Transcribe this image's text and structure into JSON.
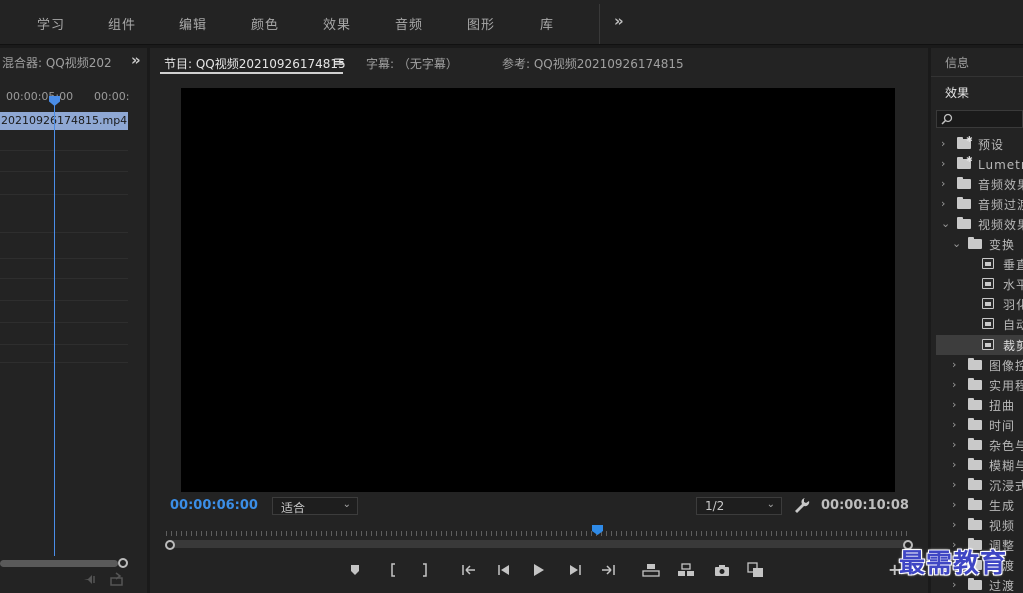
{
  "workspaces": [
    "学习",
    "组件",
    "编辑",
    "颜色",
    "效果",
    "音频",
    "图形",
    "库"
  ],
  "workspace_more": "»",
  "mixer": {
    "title": "混合器: QQ视频202",
    "more": "»",
    "ruler": [
      "00:00:05:00",
      "00:00:"
    ],
    "clip": "20210926174815.mp4"
  },
  "program": {
    "tab_program": "节目: QQ视频20210926174815",
    "menu": "≡",
    "tab_captions": "字幕: （无字幕）",
    "tab_reference": "参考: QQ视频20210926174815",
    "timecode_current": "00:00:06:00",
    "fit_select": "适合",
    "resolution_select": "1/2",
    "timecode_duration": "00:00:10:08",
    "plus": "+"
  },
  "effects_panel": {
    "tab_info": "信息",
    "tab_effects": "效果",
    "tree": [
      {
        "label": "预设",
        "level": 0,
        "chevron": "›",
        "icon": "star-folder"
      },
      {
        "label": "Lumetri 预设",
        "level": 0,
        "chevron": "›",
        "icon": "star-folder"
      },
      {
        "label": "音频效果",
        "level": 0,
        "chevron": "›",
        "icon": "folder"
      },
      {
        "label": "音频过渡",
        "level": 0,
        "chevron": "›",
        "icon": "folder"
      },
      {
        "label": "视频效果",
        "level": 0,
        "chevron": "⌄",
        "icon": "folder"
      },
      {
        "label": "变换",
        "level": 1,
        "chevron": "⌄",
        "icon": "folder"
      },
      {
        "label": "垂直翻转",
        "level": 2,
        "chevron": "",
        "icon": "effect"
      },
      {
        "label": "水平翻转",
        "level": 2,
        "chevron": "",
        "icon": "effect"
      },
      {
        "label": "羽化边缘",
        "level": 2,
        "chevron": "",
        "icon": "effect"
      },
      {
        "label": "自动重构",
        "level": 2,
        "chevron": "",
        "icon": "effect"
      },
      {
        "label": "裁剪",
        "level": 2,
        "chevron": "",
        "icon": "effect",
        "selected": true
      },
      {
        "label": "图像控制",
        "level": 1,
        "chevron": "›",
        "icon": "folder"
      },
      {
        "label": "实用程序",
        "level": 1,
        "chevron": "›",
        "icon": "folder"
      },
      {
        "label": "扭曲",
        "level": 1,
        "chevron": "›",
        "icon": "folder"
      },
      {
        "label": "时间",
        "level": 1,
        "chevron": "›",
        "icon": "folder"
      },
      {
        "label": "杂色与颗粒",
        "level": 1,
        "chevron": "›",
        "icon": "folder"
      },
      {
        "label": "模糊与锐化",
        "level": 1,
        "chevron": "›",
        "icon": "folder"
      },
      {
        "label": "沉浸式视频",
        "level": 1,
        "chevron": "›",
        "icon": "folder"
      },
      {
        "label": "生成",
        "level": 1,
        "chevron": "›",
        "icon": "folder"
      },
      {
        "label": "视频",
        "level": 1,
        "chevron": "›",
        "icon": "folder"
      },
      {
        "label": "调整",
        "level": 1,
        "chevron": "›",
        "icon": "folder"
      },
      {
        "label": "过渡",
        "level": 1,
        "chevron": "›",
        "icon": "folder"
      },
      {
        "label": "过渡",
        "level": 1,
        "chevron": "›",
        "icon": "folder"
      }
    ]
  },
  "watermark": "最需教育",
  "colors": {
    "accent": "#3b8ee6",
    "clip": "#8fa8d4",
    "watermark": "#3f46c4"
  }
}
